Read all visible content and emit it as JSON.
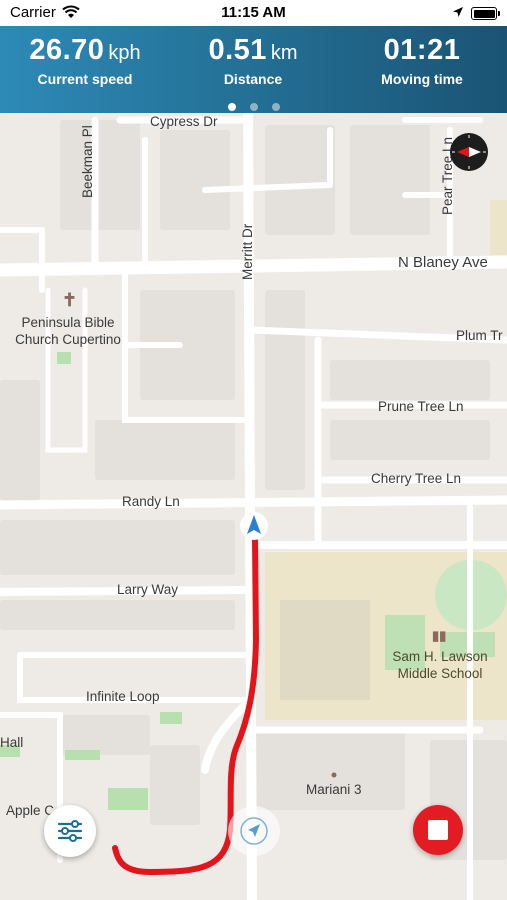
{
  "status_bar": {
    "carrier": "Carrier",
    "time": "11:15 AM"
  },
  "stats": {
    "speed": {
      "value": "26.70",
      "unit": "kph",
      "label": "Current speed"
    },
    "distance": {
      "value": "0.51",
      "unit": "km",
      "label": "Distance"
    },
    "moving_time": {
      "value": "01:21",
      "label": "Moving time"
    },
    "pages": 3,
    "active_page": 1
  },
  "header_gradient": {
    "from": "#2d8ab6",
    "to": "#1a5474"
  },
  "map": {
    "streets": {
      "cypress": "Cypress Dr",
      "beekman": "Beekman Pl",
      "merritt": "Merritt Dr",
      "peartree": "Pear Tree Ln",
      "blaney": "N Blaney Ave",
      "plum": "Plum Tr",
      "prune": "Prune Tree Ln",
      "cherry": "Cherry Tree Ln",
      "randy": "Randy Ln",
      "larry": "Larry Way",
      "infinite": "Infinite Loop"
    },
    "places": {
      "church_line1": "Peninsula Bible",
      "church_line2": "Church Cupertino",
      "school_line1": "Sam H. Lawson",
      "school_line2": "Middle School",
      "mariani": "Mariani 3",
      "hall": "Hall",
      "apple": "Apple C   s"
    },
    "route_color": "#e3151b"
  },
  "controls": {
    "filter_icon": "sliders-icon",
    "locate_icon": "navigation-arrow-icon",
    "stop_icon": "stop-icon",
    "compass_icon": "compass-icon"
  }
}
